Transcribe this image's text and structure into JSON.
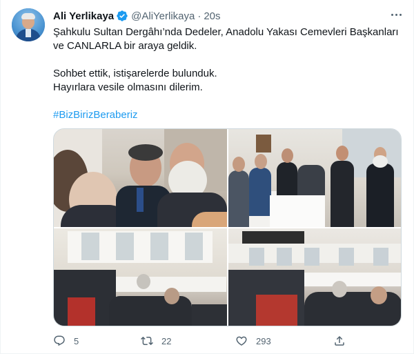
{
  "author": {
    "name": "Ali Yerlikaya",
    "handle": "@AliYerlikaya",
    "separator": "·",
    "time": "20s"
  },
  "tweet": {
    "line1": "Şahkulu Sultan Dergâhı’nda Dedeler, Anadolu Yakası Cemevleri Başkanları",
    "line2": "ve CANLARLA bir araya geldik.",
    "line3": "Sohbet ettik, istişarelerde bulunduk.",
    "line4": "Hayırlara vesile olmasını dilerim.",
    "hashtag": "#BizBirizBeraberiz"
  },
  "actions": {
    "replies": "5",
    "retweets": "22",
    "likes": "293"
  },
  "colors": {
    "accent": "#1d9bf0",
    "text": "#0f1419",
    "muted": "#536471",
    "border": "#cfd9de"
  },
  "icons": [
    "verified-badge-icon",
    "more-dots-icon",
    "reply-icon",
    "retweet-icon",
    "like-icon",
    "share-icon"
  ]
}
